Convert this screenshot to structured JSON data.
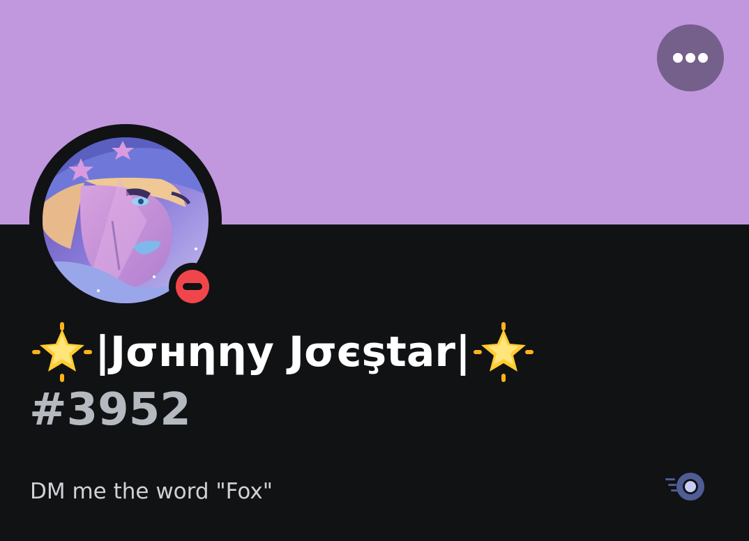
{
  "profile": {
    "banner_color": "#c197de",
    "username": "|Jσнηηу Jσєştar|",
    "discriminator": "#3952",
    "status": "do-not-disturb",
    "bio": "DM me the word \"Fox\""
  },
  "icons": {
    "more": "more-horizontal-icon",
    "star": "glowing-star-icon",
    "nitro": "nitro-badge-icon",
    "status": "dnd-status-icon"
  },
  "colors": {
    "background": "#111214",
    "more_button": "#74608a",
    "dnd_red": "#f0464b",
    "discriminator": "#b5bac1"
  }
}
